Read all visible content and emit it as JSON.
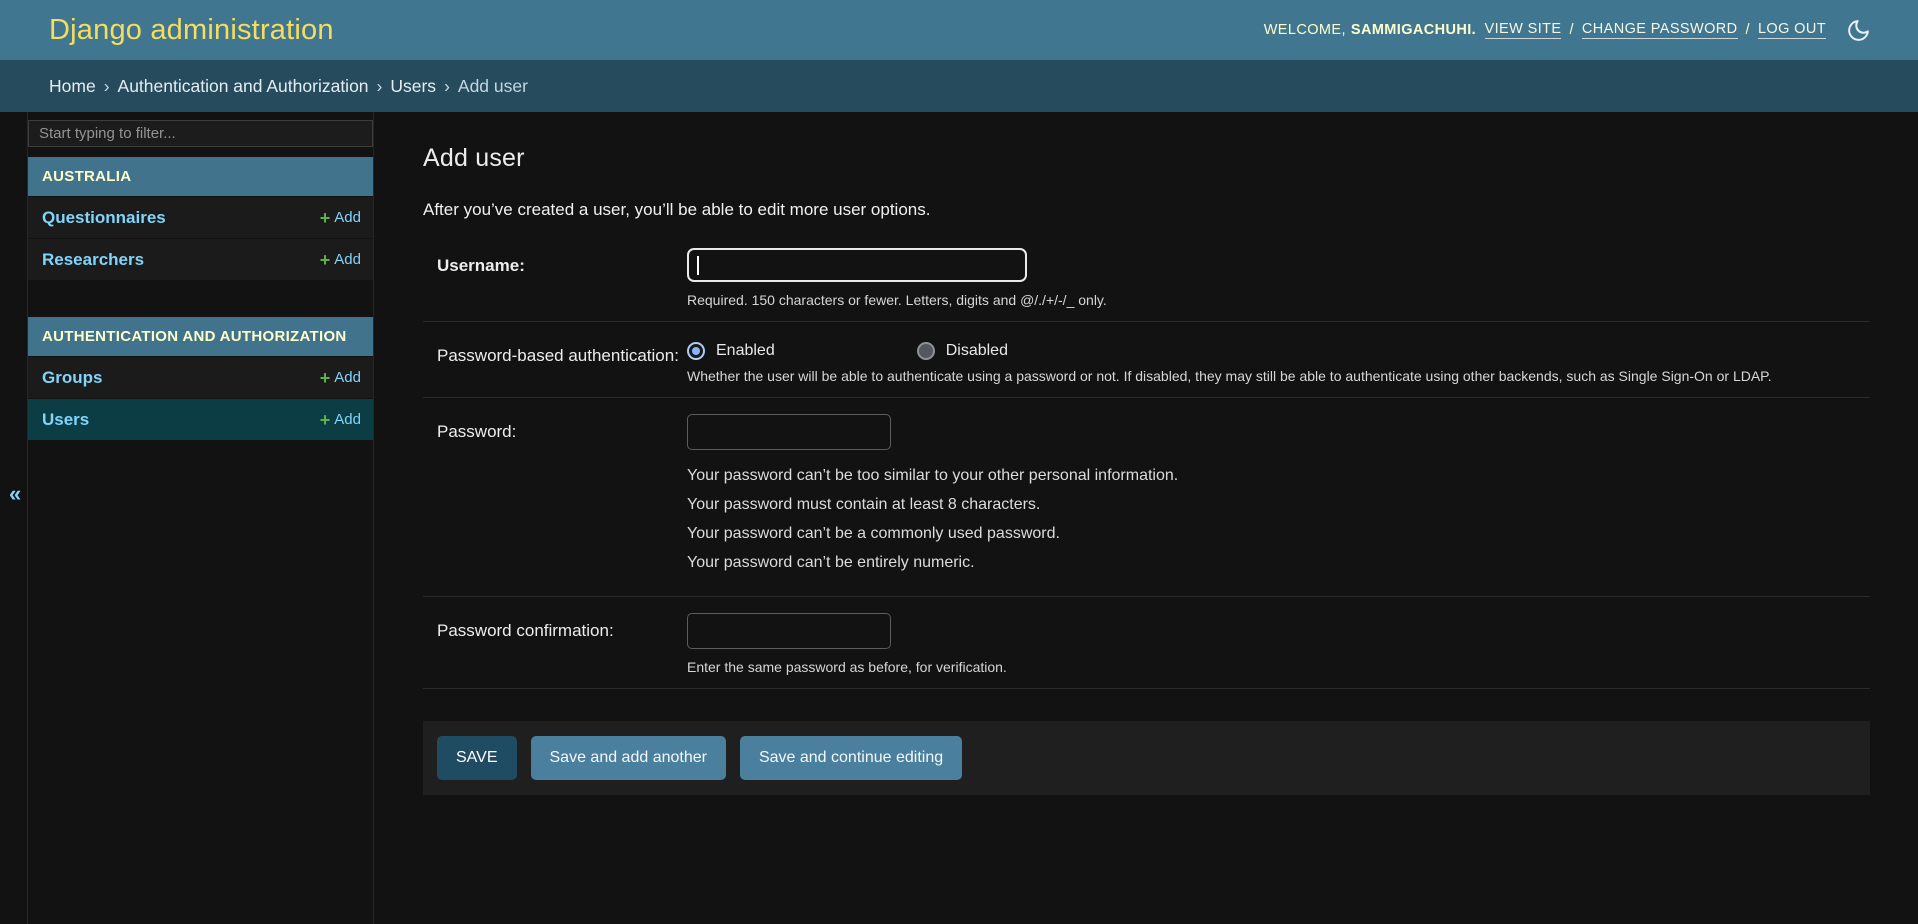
{
  "colors": {
    "header-bg": "#417690",
    "accent": "#f5dd5d",
    "breadcrumbs-bg": "#264b5d",
    "body-bg": "#121212",
    "link": "#81d4fa",
    "caption-bg": "#41738c",
    "caption-fg": "#ffffcc",
    "selected-row-bg": "#0c3d45",
    "add-plus": "#5fb341",
    "save-button-bg": "#1f4c63",
    "secondary-button-bg": "#4a7f9d",
    "submit-row-bg": "#1f1f1f"
  },
  "header": {
    "brand": "Django administration",
    "welcome": "WELCOME,",
    "username": "SAMMIGACHUHI.",
    "view_site": "VIEW SITE",
    "change_password": "CHANGE PASSWORD",
    "log_out": "LOG OUT",
    "separator": "/",
    "theme_icon": "moon-icon"
  },
  "breadcrumbs": {
    "separator": "›",
    "items": [
      "Home",
      "Authentication and Authorization",
      "Users",
      "Add user"
    ]
  },
  "sidebar": {
    "toggle": "«",
    "filter_placeholder": "Start typing to filter...",
    "add_plus": "+",
    "sections": [
      {
        "title": "AUSTRALIA",
        "items": [
          {
            "label": "Questionnaires",
            "add_label": "Add"
          },
          {
            "label": "Researchers",
            "add_label": "Add"
          }
        ]
      },
      {
        "title": "AUTHENTICATION AND AUTHORIZATION",
        "items": [
          {
            "label": "Groups",
            "add_label": "Add"
          },
          {
            "label": "Users",
            "add_label": "Add",
            "selected": true
          }
        ]
      }
    ]
  },
  "main": {
    "title": "Add user",
    "intro": "After you’ve created a user, you’ll be able to edit more user options.",
    "form": {
      "username": {
        "label": "Username:",
        "value": "",
        "help": "Required. 150 characters or fewer. Letters, digits and @/./+/-/_ only."
      },
      "auth": {
        "label": "Password-based authentication:",
        "options": [
          {
            "label": "Enabled",
            "selected": true
          },
          {
            "label": "Disabled",
            "selected": false
          }
        ],
        "help": "Whether the user will be able to authenticate using a password or not. If disabled, they may still be able to authenticate using other backends, such as Single Sign-On or LDAP."
      },
      "password": {
        "label": "Password:",
        "value": "",
        "help_items": [
          "Your password can’t be too similar to your other personal information.",
          "Your password must contain at least 8 characters.",
          "Your password can’t be a commonly used password.",
          "Your password can’t be entirely numeric."
        ]
      },
      "password2": {
        "label": "Password confirmation:",
        "value": "",
        "help": "Enter the same password as before, for verification."
      },
      "buttons": {
        "save": "SAVE",
        "save_add": "Save and add another",
        "save_continue": "Save and continue editing"
      }
    }
  }
}
